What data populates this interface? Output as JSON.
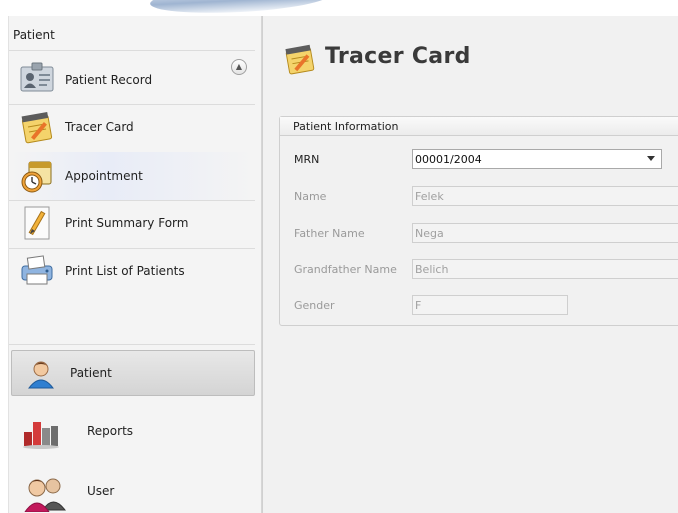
{
  "window": {
    "accent": "#3d7fc1"
  },
  "nav": {
    "header": "Patient",
    "collapse_icon": "chevron-up-icon",
    "items": [
      {
        "label": "Patient Record",
        "icon": "id-card-icon"
      },
      {
        "label": "Tracer Card",
        "icon": "notepad-pencil-icon"
      },
      {
        "label": "Appointment",
        "icon": "calendar-clock-icon"
      },
      {
        "label": "Print Summary Form",
        "icon": "pencil-document-icon"
      },
      {
        "label": "Print List of Patients",
        "icon": "printer-icon"
      }
    ],
    "selected_item": "Appointment",
    "buttons": [
      {
        "label": "Patient",
        "icon": "person-icon",
        "active": true
      },
      {
        "label": "Reports",
        "icon": "bar-chart-icon",
        "active": false
      },
      {
        "label": "User",
        "icon": "users-icon",
        "active": false
      }
    ]
  },
  "main": {
    "title": "Tracer Card",
    "title_icon": "notepad-pencil-icon",
    "group": {
      "title": "Patient Information",
      "fields": [
        {
          "label": "MRN",
          "value": "00001/2004",
          "type": "combo"
        },
        {
          "label": "Name",
          "value": "Felek",
          "type": "readonly"
        },
        {
          "label": "Father Name",
          "value": "Nega",
          "type": "readonly"
        },
        {
          "label": "Grandfather Name",
          "value": "Belich",
          "type": "readonly"
        },
        {
          "label": "Gender",
          "value": "F",
          "type": "readonly"
        }
      ]
    }
  }
}
